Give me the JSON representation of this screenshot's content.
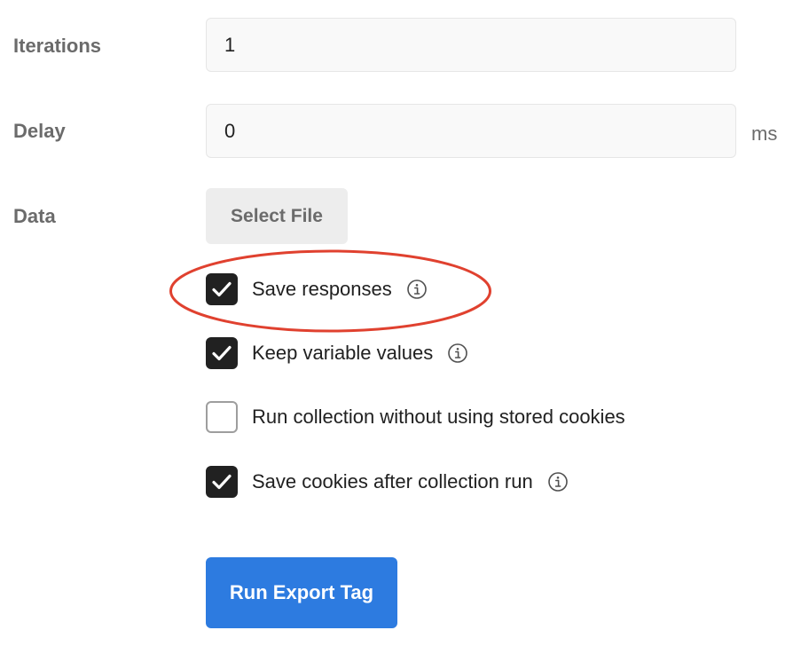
{
  "iterations": {
    "label": "Iterations",
    "value": "1"
  },
  "delay": {
    "label": "Delay",
    "value": "0",
    "unit": "ms"
  },
  "data": {
    "label": "Data",
    "select_file_label": "Select File"
  },
  "options": [
    {
      "label": "Save responses",
      "checked": true,
      "has_info": true,
      "highlighted": true
    },
    {
      "label": "Keep variable values",
      "checked": true,
      "has_info": true
    },
    {
      "label": "Run collection without using stored cookies",
      "checked": false,
      "has_info": false
    },
    {
      "label": "Save cookies after collection run",
      "checked": true,
      "has_info": true
    }
  ],
  "run_button": {
    "label": "Run Export Tag"
  },
  "colors": {
    "primary": "#2d7be0",
    "highlight": "#e0412f",
    "checkbox_checked": "#212121"
  },
  "icons": {
    "check": "checkmark-icon",
    "info": "info-circle-icon"
  }
}
